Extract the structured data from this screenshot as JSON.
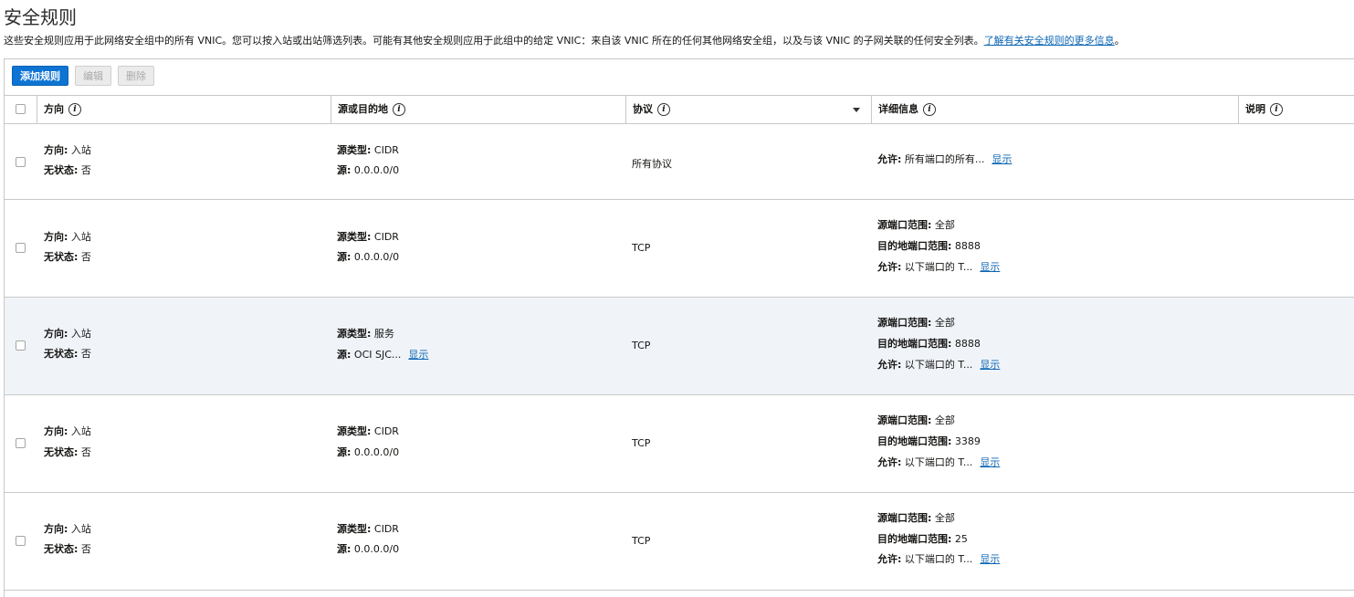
{
  "page": {
    "title": "安全规则",
    "description": "这些安全规则应用于此网络安全组中的所有 VNIC。您可以按入站或出站筛选列表。可能有其他安全规则应用于此组中的给定 VNIC：来自该 VNIC 所在的任何其他网络安全组，以及与该 VNIC 的子网关联的任何安全列表。",
    "learn_more_link": "了解有关安全规则的更多信息",
    "period": "。"
  },
  "toolbar": {
    "add_label": "添加规则",
    "edit_label": "编辑",
    "delete_label": "删除"
  },
  "columns": {
    "direction": "方向",
    "source": "源或目的地",
    "protocol": "协议",
    "details": "详细信息",
    "description": "说明",
    "info_glyph": "i"
  },
  "labels": {
    "direction": "方向:",
    "stateless": "无状态:",
    "source_type": "源类型:",
    "source": "源:",
    "allow": "允许:",
    "src_port": "源端口范围:",
    "dst_port": "目的地端口范围:",
    "show": "显示"
  },
  "rows": [
    {
      "direction": "入站",
      "stateless": "否",
      "source_type": "CIDR",
      "source": "0.0.0.0/0",
      "protocol": "所有协议",
      "allow": "所有端口的所有...",
      "highlight": false
    },
    {
      "direction": "入站",
      "stateless": "否",
      "source_type": "CIDR",
      "source": "0.0.0.0/0",
      "protocol": "TCP",
      "src_port": "全部",
      "dst_port": "8888",
      "allow": "以下端口的 T...",
      "highlight": false
    },
    {
      "direction": "入站",
      "stateless": "否",
      "source_type": "服务",
      "source": "OCI SJC...",
      "source_link": true,
      "protocol": "TCP",
      "src_port": "全部",
      "dst_port": "8888",
      "allow": "以下端口的 T...",
      "highlight": true
    },
    {
      "direction": "入站",
      "stateless": "否",
      "source_type": "CIDR",
      "source": "0.0.0.0/0",
      "protocol": "TCP",
      "src_port": "全部",
      "dst_port": "3389",
      "allow": "以下端口的 T...",
      "highlight": false
    },
    {
      "direction": "入站",
      "stateless": "否",
      "source_type": "CIDR",
      "source": "0.0.0.0/0",
      "protocol": "TCP",
      "src_port": "全部",
      "dst_port": "25",
      "allow": "以下端口的 T...",
      "highlight": false
    }
  ],
  "colors": {
    "primary": "#0e74d3",
    "link": "#0b65b3",
    "highlight_row": "#f0f4f9"
  }
}
